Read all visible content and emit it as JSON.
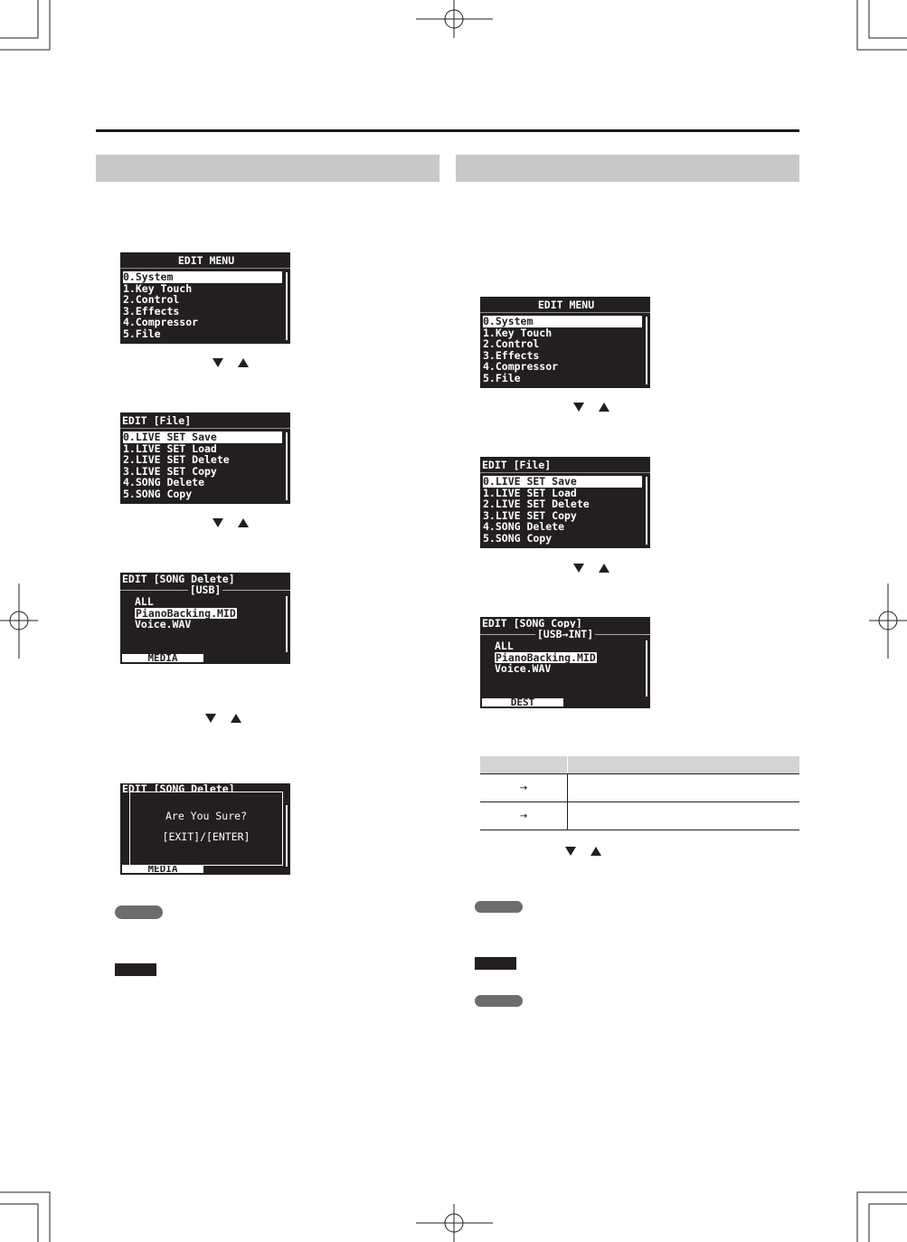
{
  "colors": {
    "lcd_bg": "#231f20",
    "section_bar": "#c8c8c8",
    "note_badge": "#6d6d6d",
    "warn_badge": "#231f20"
  },
  "icons": {
    "down": "down-triangle-icon",
    "up": "up-triangle-icon",
    "arrow": "right-arrow-icon"
  },
  "left": {
    "edit_menu": {
      "title": "EDIT MENU",
      "items": [
        "0.System",
        "1.Key Touch",
        "2.Control",
        "3.Effects",
        "4.Compressor",
        "5.File"
      ]
    },
    "file_menu": {
      "title": "EDIT [File]",
      "items": [
        "0.LIVE SET Save",
        "1.LIVE SET Load",
        "2.LIVE SET Delete",
        "3.LIVE SET Copy",
        "4.SONG Delete",
        "5.SONG Copy"
      ]
    },
    "song_delete": {
      "title": "EDIT [SONG Delete]",
      "media": "[USB]",
      "files": [
        "ALL",
        "PianoBacking.MID",
        "Voice.WAV"
      ],
      "footer": "MEDIA"
    },
    "confirm": {
      "title": "EDIT [SONG Delete]",
      "question": "Are You Sure?",
      "keys": "[EXIT]/[ENTER]",
      "footer": "MEDIA"
    }
  },
  "right": {
    "edit_menu": {
      "title": "EDIT MENU",
      "items": [
        "0.System",
        "1.Key Touch",
        "2.Control",
        "3.Effects",
        "4.Compressor",
        "5.File"
      ]
    },
    "file_menu": {
      "title": "EDIT [File]",
      "items": [
        "0.LIVE SET Save",
        "1.LIVE SET Load",
        "2.LIVE SET Delete",
        "3.LIVE SET Copy",
        "4.SONG Delete",
        "5.SONG Copy"
      ]
    },
    "song_copy": {
      "title": "EDIT [SONG Copy]",
      "media": "[USB→INT]",
      "files": [
        "ALL",
        "PianoBacking.MID",
        "Voice.WAV"
      ],
      "footer": "DEST"
    },
    "table": {
      "rows": [
        {
          "arrow": "→"
        },
        {
          "arrow": "→"
        }
      ]
    }
  }
}
